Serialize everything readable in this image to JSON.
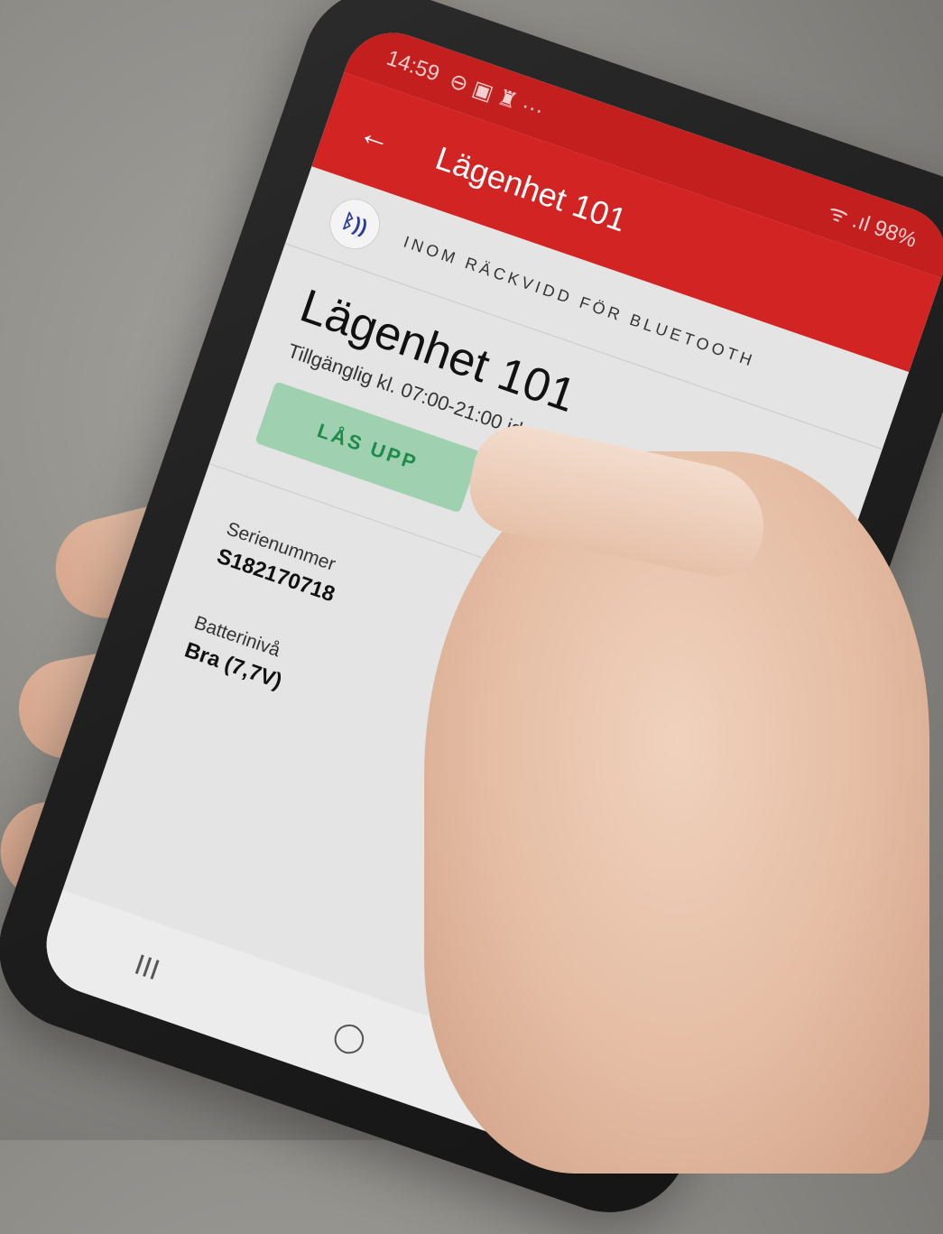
{
  "status_bar": {
    "time": "14:59",
    "icons_left": "⊖ ▣ ♜ ···",
    "signal": "ᯤ .ıl 98%"
  },
  "app_bar": {
    "back_icon": "arrow-left-icon",
    "title": "Lägenhet 101"
  },
  "bluetooth": {
    "icon": "bluetooth-icon",
    "status": "INOM RÄCKVIDD FÖR BLUETOOTH"
  },
  "lock": {
    "name": "Lägenhet 101",
    "availability": "Tillgänglig kl. 07:00-21:00 idag",
    "unlock_label": "LÅS UPP"
  },
  "details": {
    "serial_label": "Serienummer",
    "serial_value": "S182170718",
    "battery_label": "Batterinivå",
    "battery_value": "Bra (7,7V)"
  },
  "nav_bar": {
    "recents": "III",
    "home": "◯",
    "back": "<"
  },
  "colors": {
    "app_bar": "#d32424",
    "unlock_button": "#9fd1b0",
    "unlock_text": "#1f8a4c"
  }
}
